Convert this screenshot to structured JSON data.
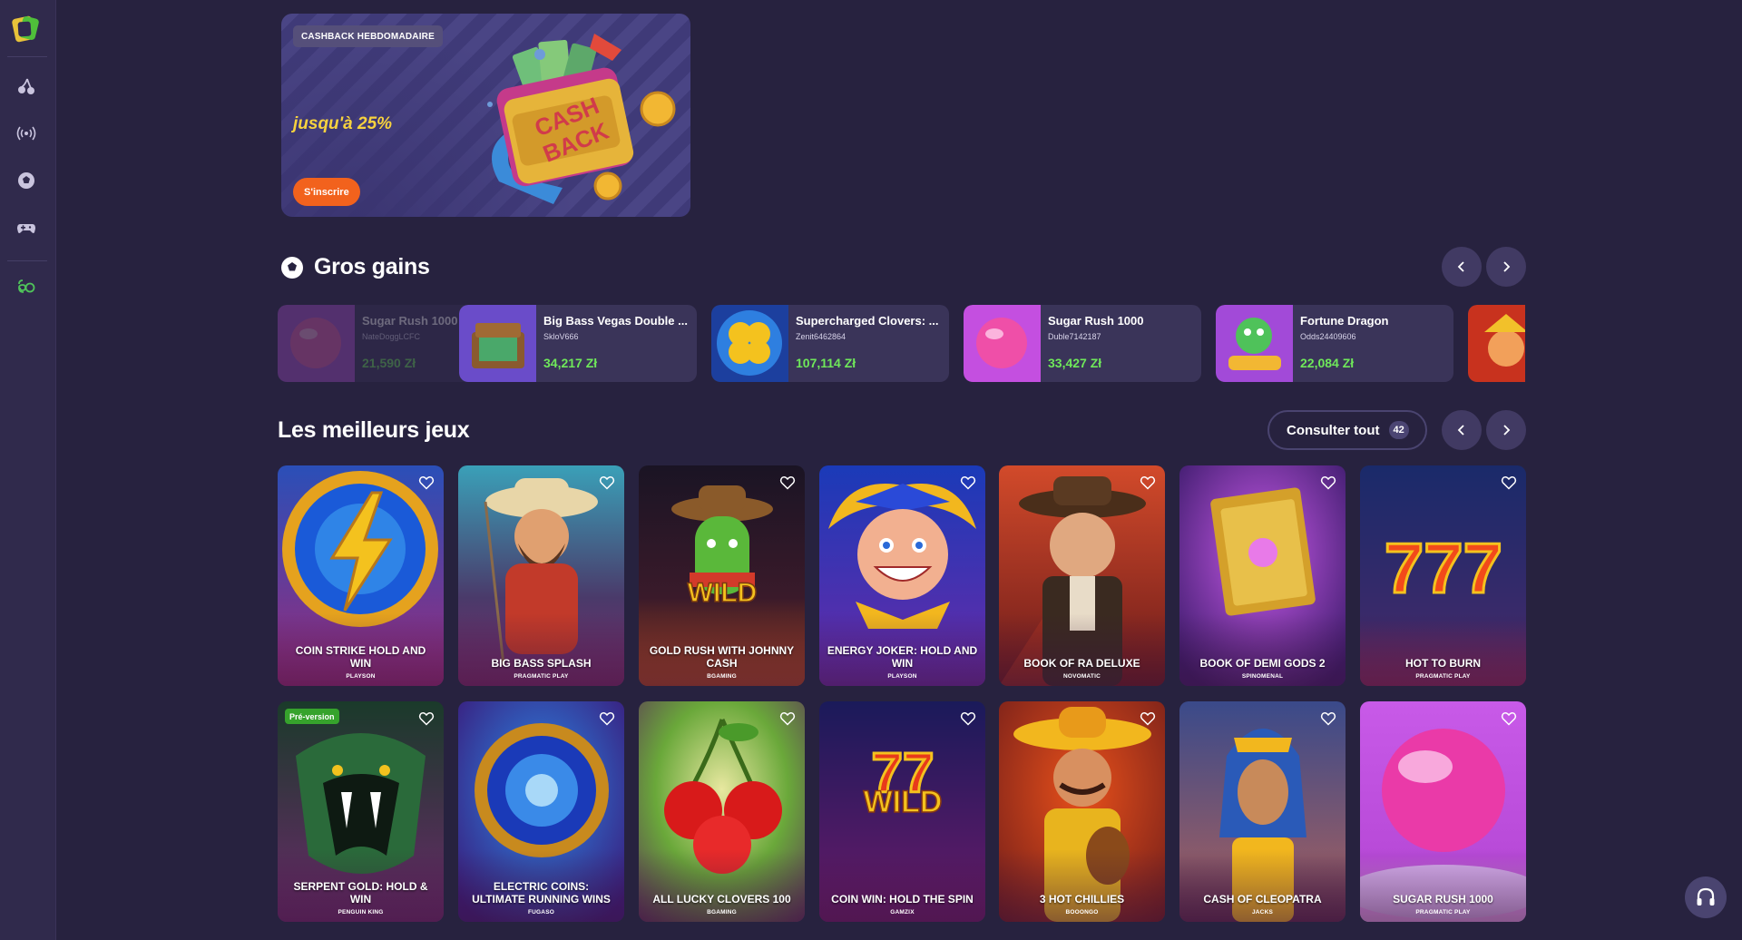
{
  "sidebar": {
    "items": [
      {
        "icon": "cherries-icon"
      },
      {
        "icon": "live-broadcast-icon"
      },
      {
        "icon": "football-icon"
      },
      {
        "icon": "gamepad-icon"
      },
      {
        "icon": "responsible-gaming-icon"
      }
    ]
  },
  "promo": {
    "tag": "CASHBACK HEBDOMADAIRE",
    "value": "jusqu'à 25%",
    "button": "S'inscrire",
    "art_text_1": "CASH",
    "art_text_2": "BACK"
  },
  "big_wins": {
    "title": "Gros gains",
    "items": [
      {
        "game": "Sugar Rush 1000",
        "user": "NateDoggLCFC",
        "amount": "21,590 Zł"
      },
      {
        "game": "Big Bass Vegas Double ...",
        "user": "SkloV666",
        "amount": "34,217 Zł"
      },
      {
        "game": "Supercharged Clovers: ...",
        "user": "Zenit6462864",
        "amount": "107,114 Zł"
      },
      {
        "game": "Sugar Rush 1000",
        "user": "Duble7142187",
        "amount": "33,427 Zł"
      },
      {
        "game": "Fortune Dragon",
        "user": "Odds24409606",
        "amount": "22,084 Zł"
      }
    ]
  },
  "best_games": {
    "title": "Les meilleurs jeux",
    "see_all": "Consulter tout",
    "count": "42",
    "tiles": [
      {
        "title": "COIN STRIKE HOLD AND WIN",
        "provider": "PLAYSON"
      },
      {
        "title": "BIG BASS SPLASH",
        "provider": "PRAGMATIC PLAY"
      },
      {
        "title": "GOLD RUSH WITH JOHNNY CASH",
        "provider": "BGAMING"
      },
      {
        "title": "ENERGY JOKER: HOLD AND WIN",
        "provider": "PLAYSON"
      },
      {
        "title": "BOOK OF RA DELUXE",
        "provider": "NOVOMATIC"
      },
      {
        "title": "BOOK OF DEMI GODS 2",
        "provider": "SPINOMENAL"
      },
      {
        "title": "HOT TO BURN",
        "provider": "PRAGMATIC PLAY"
      },
      {
        "title": "SERPENT GOLD: HOLD & WIN",
        "provider": "PENGUIN KING",
        "badge": "Pré-version"
      },
      {
        "title": "ELECTRIC COINS: ULTIMATE RUNNING WINS",
        "provider": "FUGASO"
      },
      {
        "title": "ALL LUCKY CLOVERS 100",
        "provider": "BGAMING"
      },
      {
        "title": "COIN WIN: HOLD THE SPIN",
        "provider": "GAMZIX"
      },
      {
        "title": "3 HOT CHILLIES",
        "provider": "BOOONGO"
      },
      {
        "title": "CASH OF CLEOPATRA",
        "provider": "JACKS"
      },
      {
        "title": "SUGAR RUSH 1000",
        "provider": "PRAGMATIC PLAY"
      }
    ],
    "art_texts": {
      "wild": "WILD"
    }
  },
  "colors": {
    "background": "#27223f",
    "sidebar": "#302a4c",
    "accent_orange": "#f2621d",
    "win_green": "#6fe85a",
    "badge_green": "#36a32c"
  }
}
